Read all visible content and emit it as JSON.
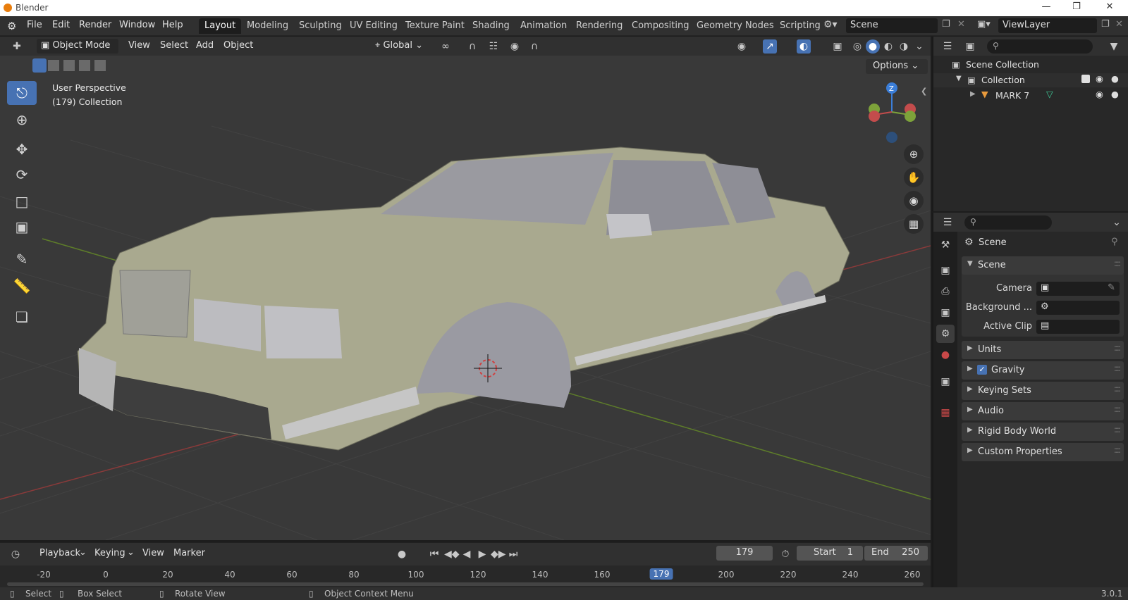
{
  "window": {
    "title": "Blender",
    "version": "3.0.1"
  },
  "menu": [
    "File",
    "Edit",
    "Render",
    "Window",
    "Help"
  ],
  "workspaces": [
    "Layout",
    "Modeling",
    "Sculpting",
    "UV Editing",
    "Texture Paint",
    "Shading",
    "Animation",
    "Rendering",
    "Compositing",
    "Geometry Nodes",
    "Scripting"
  ],
  "active_workspace": "Layout",
  "scene_field": "Scene",
  "viewlayer_field": "ViewLayer",
  "viewport_header": {
    "mode": "Object Mode",
    "menus": [
      "View",
      "Select",
      "Add",
      "Object"
    ],
    "orientation": "Global",
    "options_label": "Options"
  },
  "viewport": {
    "perspective_label": "User Perspective",
    "collection_label": "(179) Collection",
    "gizmo_axes": {
      "z": "Z",
      "x": "X",
      "y": "Y"
    }
  },
  "outliner": {
    "rows": [
      {
        "label": "Scene Collection"
      },
      {
        "label": "Collection"
      },
      {
        "label": "MARK 7"
      }
    ]
  },
  "properties": {
    "context_title": "Scene",
    "scene_section": "Scene",
    "camera_label": "Camera",
    "background_label": "Background ...",
    "active_clip_label": "Active Clip",
    "sections": [
      "Units",
      "Gravity",
      "Keying Sets",
      "Audio",
      "Rigid Body World",
      "Custom Properties"
    ],
    "gravity_checked": true
  },
  "timeline": {
    "menus": [
      "Playback",
      "Keying",
      "View",
      "Marker"
    ],
    "current_frame": "179",
    "start_label": "Start",
    "start_value": "1",
    "end_label": "End",
    "end_value": "250",
    "ticks": [
      "-20",
      "0",
      "20",
      "40",
      "60",
      "80",
      "100",
      "120",
      "140",
      "160",
      "179",
      "200",
      "220",
      "240",
      "260"
    ]
  },
  "statusbar": {
    "select": "Select",
    "box_select": "Box Select",
    "rotate_view": "Rotate View",
    "context_menu": "Object Context Menu"
  },
  "colors": {
    "accent": "#4772b3",
    "car_body": "#b8b8a0",
    "viewport_bg": "#393939",
    "axis_x": "#c34c4c",
    "axis_y": "#7da23a",
    "axis_z": "#3b7ed8"
  }
}
